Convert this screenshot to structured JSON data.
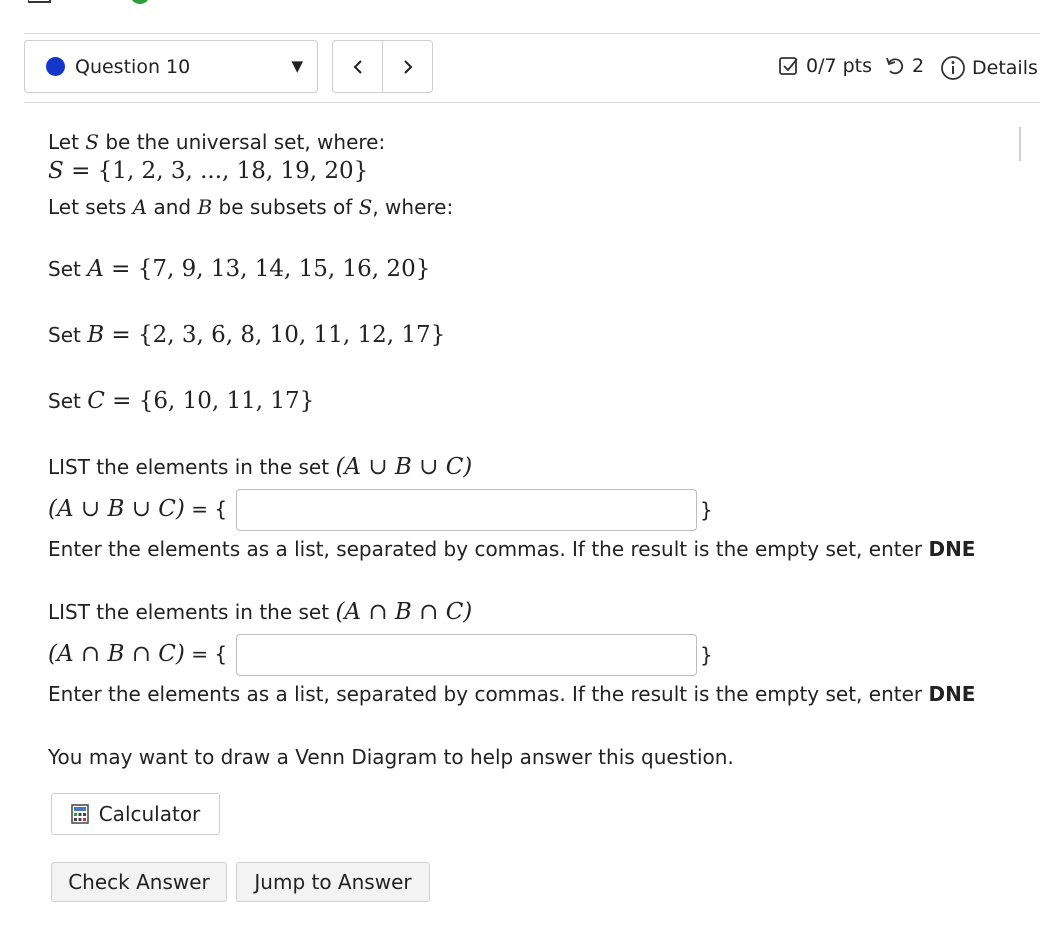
{
  "header": {
    "question_label": "Question 10",
    "points": "0/7 pts",
    "attempts": "2",
    "details_label": "Details"
  },
  "problem": {
    "line1_pre": "Let ",
    "line1_var": "S",
    "line1_post": " be the universal set, where:",
    "universal_lhs": "S",
    "universal_rhs": "{1, 2, 3, ..., 18, 19, 20}",
    "line3_pre": "Let sets ",
    "line3_a": "A",
    "line3_and": " and ",
    "line3_b": "B",
    "line3_mid": " be subsets of ",
    "line3_s": "S",
    "line3_post": ", where:",
    "set_word": "Set ",
    "set_a_name": "A",
    "set_a_value": "{7, 9, 13, 14, 15, 16, 20}",
    "set_b_name": "B",
    "set_b_value": "{2, 3, 6, 8, 10, 11, 12, 17}",
    "set_c_name": "C",
    "set_c_value": "{6, 10, 11, 17}"
  },
  "parts": [
    {
      "prompt": "LIST the elements in the set ",
      "expr": "(A ∪ B ∪ C)",
      "answer_prefix": " = {",
      "answer_suffix": "}",
      "answer_value": "",
      "instruction": "Enter the elements as a list, separated by commas. If the result is the empty set, enter ",
      "instruction_bold": "DNE"
    },
    {
      "prompt": "LIST the elements in the set ",
      "expr": "(A ∩ B ∩ C)",
      "answer_prefix": " = {",
      "answer_suffix": "}",
      "answer_value": "",
      "instruction": "Enter the elements as a list, separated by commas. If the result is the empty set, enter ",
      "instruction_bold": "DNE"
    }
  ],
  "hint": "You may want to draw a Venn Diagram to help answer this question.",
  "buttons": {
    "calculator": "Calculator",
    "check_answer": "Check Answer",
    "jump_to_answer": "Jump to Answer"
  },
  "colors": {
    "question_dot": "#1537c9",
    "accent_green": "#2e9e3b"
  }
}
